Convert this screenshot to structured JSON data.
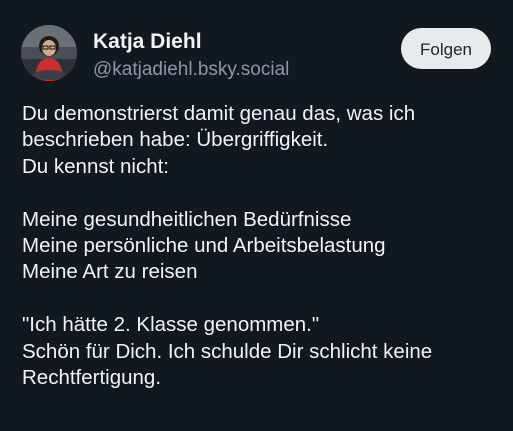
{
  "author": {
    "display_name": "Katja Diehl",
    "handle": "@katjadiehl.bsky.social",
    "avatar_icon": "profile-photo"
  },
  "follow_button": {
    "label": "Folgen"
  },
  "post": {
    "lines": [
      "Du demonstrierst damit genau das, was ich",
      "beschrieben habe: Übergriffigkeit.",
      "Du kennst nicht:",
      "",
      "Meine gesundheitlichen Bedürfnisse",
      "Meine persönliche und Arbeitsbelastung",
      "Meine Art zu reisen",
      "",
      "\"Ich hätte 2. Klasse genommen.\"",
      "Schön für Dich. Ich schulde Dir schlicht keine",
      "Rechtfertigung."
    ]
  },
  "colors": {
    "background": "#111820",
    "text": "#f1f3f5",
    "handle": "#8b98a5",
    "button_bg": "#e8ebee",
    "button_text": "#1b232c"
  }
}
